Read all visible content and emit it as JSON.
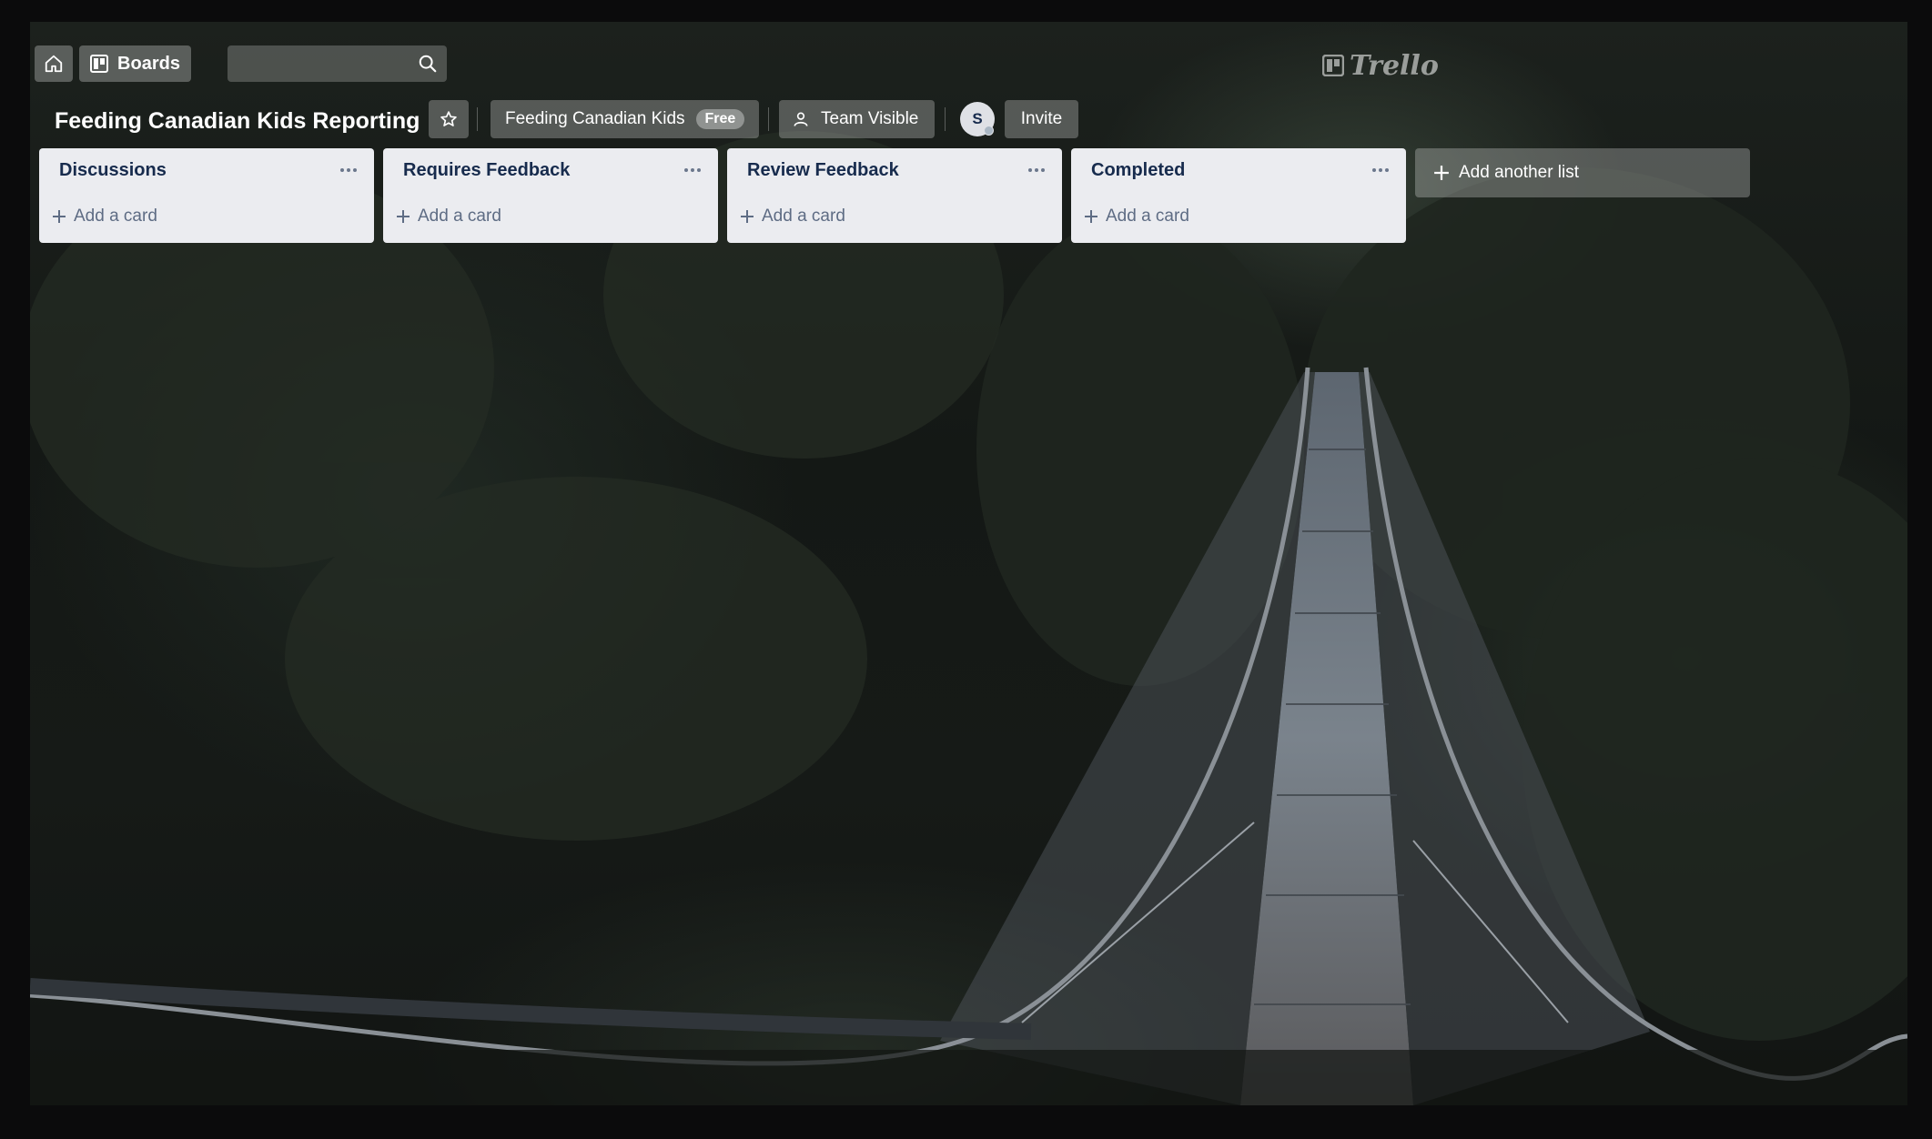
{
  "app": {
    "brand": "Trello",
    "home_icon": "home-icon",
    "boards_label": "Boards",
    "search_value": ""
  },
  "board": {
    "title": "Feeding Canadian Kids Reporting",
    "team_name": "Feeding Canadian Kids",
    "team_plan": "Free",
    "visibility_label": "Team Visible",
    "member_initial": "S",
    "invite_label": "Invite"
  },
  "lists": [
    {
      "title": "Discussions",
      "add_card": "Add a card"
    },
    {
      "title": "Requires Feedback",
      "add_card": "Add a card"
    },
    {
      "title": "Review Feedback",
      "add_card": "Add a card"
    },
    {
      "title": "Completed",
      "add_card": "Add a card"
    }
  ],
  "add_list_label": "Add another list",
  "colors": {
    "list_bg": "#ebecf0",
    "list_title": "#172b4d",
    "muted_text": "#5e6c84"
  }
}
